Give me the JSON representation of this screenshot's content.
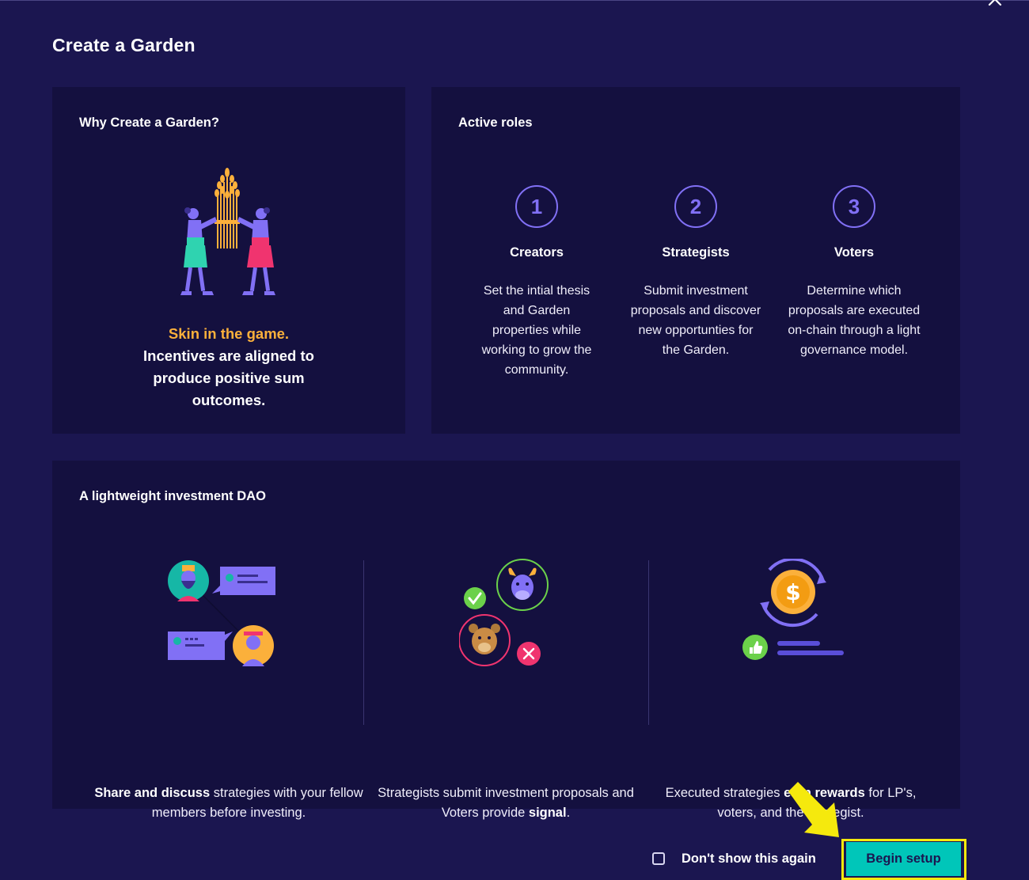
{
  "modal": {
    "title": "Create a Garden"
  },
  "why_card": {
    "title": "Why Create a Garden?",
    "highlight": "Skin in the game.",
    "body": "Incentives are aligned to produce positive sum outcomes."
  },
  "roles_card": {
    "title": "Active roles",
    "roles": [
      {
        "number": "1",
        "name": "Creators",
        "description": "Set the intial thesis and Garden properties while working to grow the community."
      },
      {
        "number": "2",
        "name": "Strategists",
        "description": "Submit investment proposals and discover new opportunties for the Garden."
      },
      {
        "number": "3",
        "name": "Voters",
        "description": "Determine which proposals are executed on-chain through a light governance model."
      }
    ]
  },
  "dao_card": {
    "title": "A lightweight investment DAO",
    "columns": [
      {
        "bold": "Share and discuss",
        "text": " strategies with your fellow members before investing.",
        "tail": ""
      },
      {
        "pre": "Strategists submit investment proposals and Voters provide ",
        "bold": "signal",
        "tail": "."
      },
      {
        "pre": "Executed strategies ",
        "bold": "earn rewards",
        "tail": " for LP's, voters, and the strategist."
      }
    ]
  },
  "footer": {
    "checkbox_label": "Don't show this again",
    "checkbox_checked": false,
    "begin_label": "Begin setup"
  },
  "colors": {
    "background": "#1b1650",
    "card": "#14103f",
    "accent_purple": "#8170f5",
    "accent_orange": "#fbb03b",
    "button_teal": "#00c6b9",
    "highlight_yellow": "#f5e90d"
  }
}
